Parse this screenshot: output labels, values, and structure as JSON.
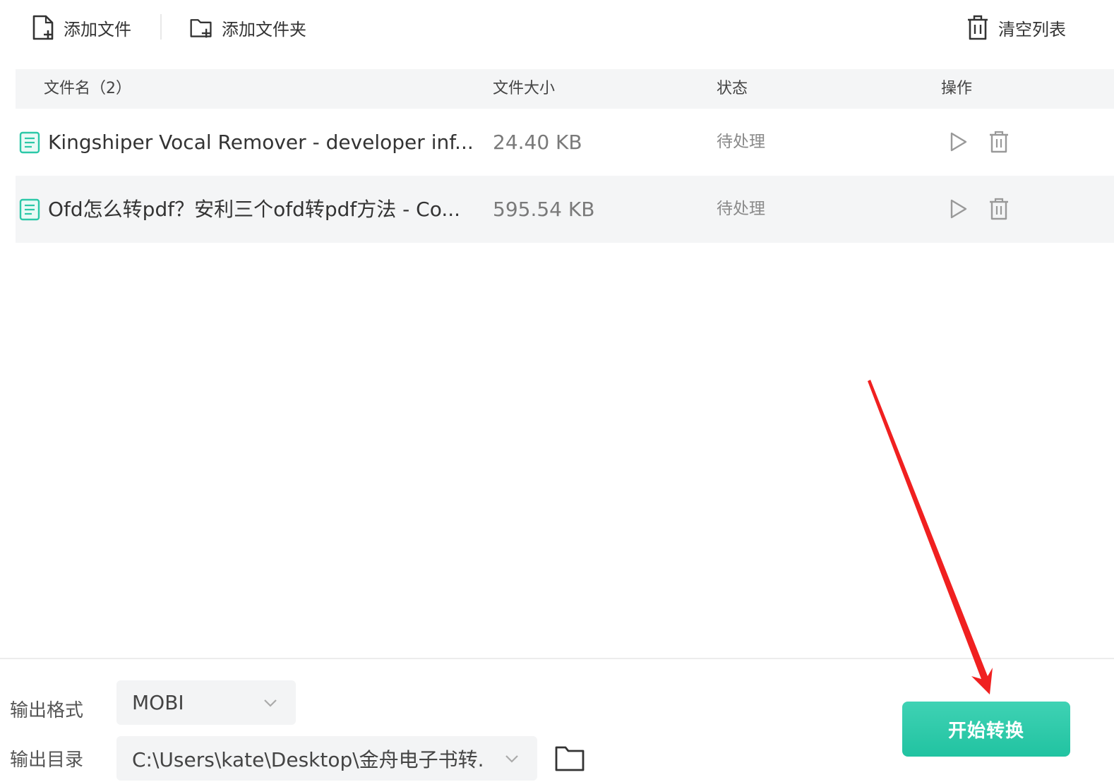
{
  "toolbar": {
    "add_file_label": "添加文件",
    "add_folder_label": "添加文件夹",
    "clear_list_label": "清空列表"
  },
  "table": {
    "headers": {
      "name": "文件名（2）",
      "size": "文件大小",
      "status": "状态",
      "action": "操作"
    },
    "rows": [
      {
        "name": "Kingshiper Vocal Remover - developer inf...",
        "size": "24.40 KB",
        "status": "待处理"
      },
      {
        "name": "Ofd怎么转pdf？安利三个ofd转pdf方法 - Co...",
        "size": "595.54 KB",
        "status": "待处理"
      }
    ]
  },
  "output": {
    "format_label": "输出格式",
    "format_value": "MOBI",
    "dir_label": "输出目录",
    "dir_value": "C:\\Users\\kate\\Desktop\\金舟电子书转..."
  },
  "start_button_label": "开始转换",
  "colors": {
    "accent": "#2cc8a8",
    "header_bg": "#f4f5f6",
    "annotation_arrow": "#f02020"
  },
  "icons": [
    "add-file-icon",
    "add-folder-icon",
    "trash-icon",
    "document-icon",
    "play-icon",
    "chevron-down-icon",
    "folder-icon"
  ]
}
